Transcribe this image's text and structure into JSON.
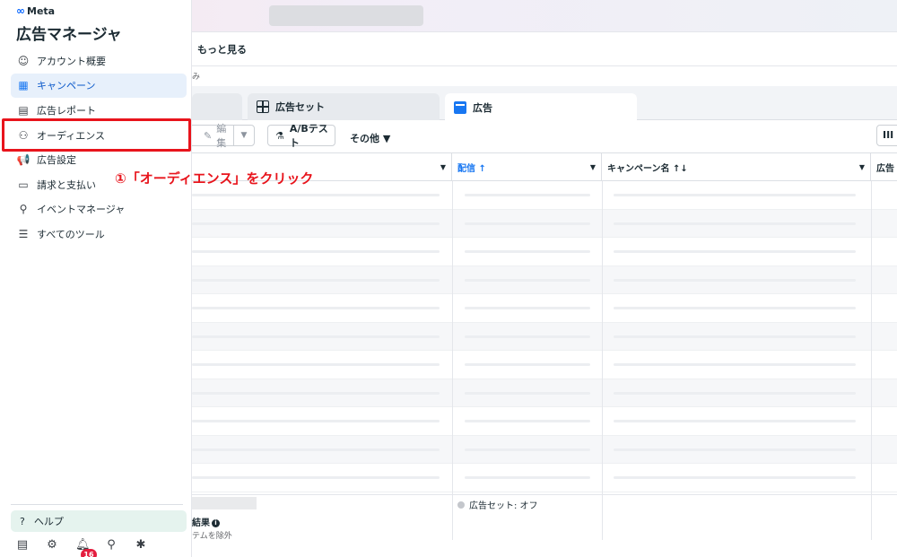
{
  "sidebar": {
    "brand": "Meta",
    "brand_logo": "∞",
    "title": "広告マネージャ",
    "items": [
      {
        "label": "アカウント概要",
        "icon": "☺"
      },
      {
        "label": "キャンペーン",
        "icon": "▦"
      },
      {
        "label": "広告レポート",
        "icon": "▤"
      },
      {
        "label": "オーディエンス",
        "icon": "⚇"
      },
      {
        "label": "広告設定",
        "icon": "📢"
      },
      {
        "label": "請求と支払い",
        "icon": "▭"
      },
      {
        "label": "イベントマネージャ",
        "icon": "⚲"
      },
      {
        "label": "すべてのツール",
        "icon": "☰"
      }
    ],
    "help": {
      "icon": "?",
      "label": "ヘルプ"
    },
    "footer": {
      "notifications_count": "16"
    }
  },
  "annotation": "①「オーディエンス」をクリック",
  "header": {
    "more_label": "もっと見る",
    "breadcrumb_fragment": "み"
  },
  "tabs": [
    {
      "label": ""
    },
    {
      "label": "広告セット"
    },
    {
      "label": "広告"
    }
  ],
  "toolbar": {
    "edit_label": "編集",
    "ab_test_label": "A/Bテスト",
    "other_label": "その他 ▼",
    "columns_label": "III"
  },
  "table": {
    "columns": [
      {
        "label": ""
      },
      {
        "label": "配信 ↑"
      },
      {
        "label": "キャンペーン名 ↑↓"
      },
      {
        "label": "広告"
      }
    ],
    "status_text": "広告セット: オフ",
    "results_label": "結果",
    "results_sub": "テムを除外"
  },
  "colors": {
    "accent": "#1877f2",
    "annotation_red": "#e8141c",
    "badge": "#e41e3f",
    "help_bg": "#e5f3ee"
  }
}
